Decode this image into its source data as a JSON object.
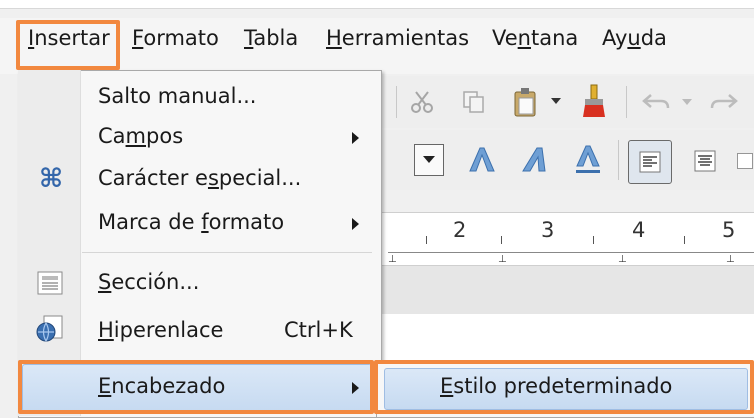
{
  "menubar": {
    "items": [
      {
        "label": "Insertar"
      },
      {
        "label": "Formato"
      },
      {
        "label": "Tabla"
      },
      {
        "label": "Herramientas"
      },
      {
        "label": "Ventana"
      },
      {
        "label": "Ayuda"
      }
    ]
  },
  "insert_menu": {
    "items": [
      {
        "label": "Salto manual...",
        "icon": "none"
      },
      {
        "label": "Campos",
        "icon": "none",
        "submenu": true
      },
      {
        "label": "Carácter especial...",
        "icon": "command-symbol-icon"
      },
      {
        "label": "Marca de formato",
        "icon": "none",
        "submenu": true
      },
      {
        "label": "Sección...",
        "icon": "section-icon"
      },
      {
        "label": "Hiperenlace",
        "icon": "hyperlink-globe-icon",
        "shortcut": "Ctrl+K"
      },
      {
        "label": "Encabezado",
        "icon": "none",
        "submenu": true,
        "highlighted": true
      }
    ]
  },
  "header_submenu": {
    "items": [
      {
        "label": "Estilo predeterminado",
        "highlighted": true
      }
    ]
  },
  "ruler": {
    "numbers": [
      "2",
      "3",
      "4",
      "5"
    ]
  },
  "colors": {
    "highlight_border": "#f2883f",
    "menu_hover": "#c6daf1"
  }
}
